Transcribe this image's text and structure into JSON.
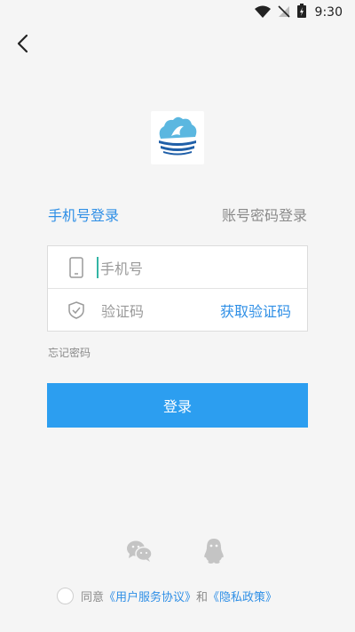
{
  "status_bar": {
    "time": "9:30",
    "icons": [
      "wifi-icon",
      "no-signal-icon",
      "battery-charging-icon"
    ]
  },
  "nav": {
    "back_icon": "chevron-left-icon"
  },
  "logo": {
    "icon": "app-logo-icon"
  },
  "tabs": {
    "phone_login": "手机号登录",
    "account_login": "账号密码登录"
  },
  "form": {
    "phone_placeholder": "手机号",
    "phone_icon": "phone-icon",
    "code_placeholder": "验证码",
    "code_icon": "shield-check-icon",
    "get_code_label": "获取验证码"
  },
  "forgot_password": "忘记密码",
  "login_button": "登录",
  "social_login": {
    "wechat_icon": "wechat-icon",
    "qq_icon": "qq-icon"
  },
  "agreement": {
    "prefix": "同意",
    "user_agreement": "《用户服务协议》",
    "and": "和",
    "privacy_policy": "《隐私政策》",
    "checked": false
  },
  "colors": {
    "accent": "#2f8fe6",
    "button": "#2c9ef0",
    "background": "#f5f5f5",
    "muted_text": "#8a8a8a"
  }
}
